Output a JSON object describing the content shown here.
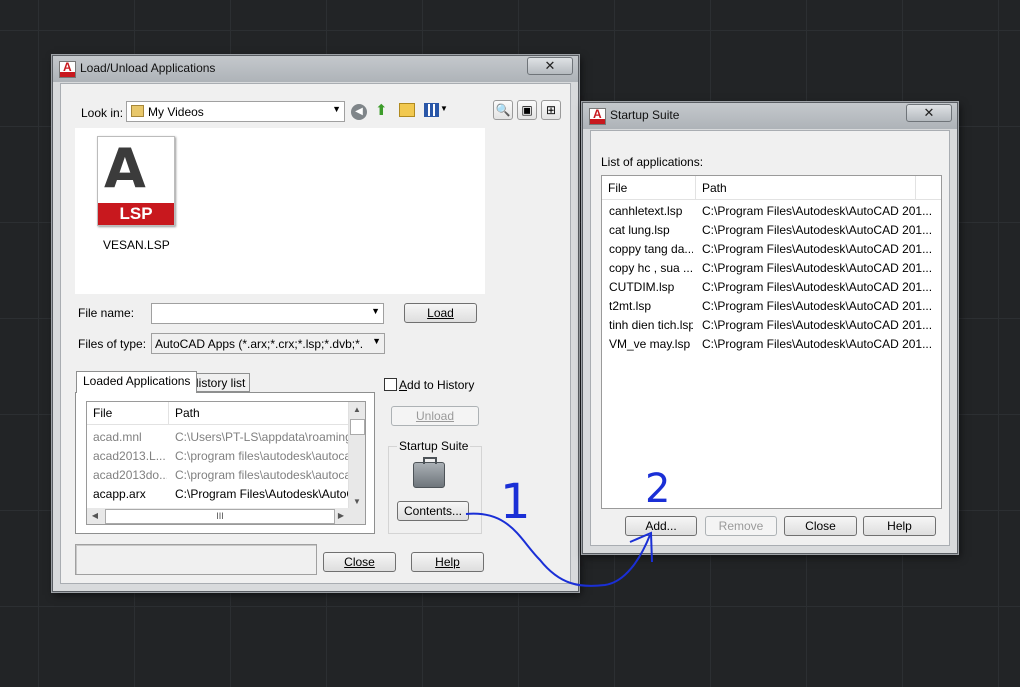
{
  "load_dialog": {
    "title": "Load/Unload Applications",
    "close_glyph": "✕",
    "look_in_label": "Look in:",
    "look_in_value": "My Videos",
    "file_icon_text": "LSP",
    "file_item_name": "VESAN.LSP",
    "file_name_label": "File name:",
    "file_name_value": "",
    "load_button": "Load",
    "files_of_type_label": "Files of type:",
    "files_of_type_value": "AutoCAD Apps (*.arx;*.crx;*.lsp;*.dvb;*.dbx;*.",
    "tabs": [
      "Loaded Applications",
      "History list"
    ],
    "add_to_history_label": "Add to History",
    "unload_button": "Unload",
    "startup_suite_label": "Startup Suite",
    "contents_button": "Contents...",
    "columns": [
      "File",
      "Path"
    ],
    "loaded_apps": [
      {
        "file": "acad.mnl",
        "path": "C:\\Users\\PT-LS\\appdata\\roaming\\.",
        "dim": true
      },
      {
        "file": "acad2013.L...",
        "path": "C:\\program files\\autodesk\\autocad .",
        "dim": true
      },
      {
        "file": "acad2013do...",
        "path": "C:\\program files\\autodesk\\autocad .",
        "dim": true
      },
      {
        "file": "acapp.arx",
        "path": "C:\\Program Files\\Autodesk\\AutoCA.",
        "dim": false
      }
    ],
    "hscroll_grip": "III",
    "status_text": "",
    "close_button": "Close",
    "help_button": "Help"
  },
  "startup_dialog": {
    "title": "Startup Suite",
    "close_glyph": "✕",
    "list_label": "List of applications:",
    "columns": [
      "File",
      "Path"
    ],
    "apps": [
      {
        "file": "canhletext.lsp",
        "path": "C:\\Program Files\\Autodesk\\AutoCAD 201..."
      },
      {
        "file": "cat lung.lsp",
        "path": "C:\\Program Files\\Autodesk\\AutoCAD 201..."
      },
      {
        "file": "coppy tang da...",
        "path": "C:\\Program Files\\Autodesk\\AutoCAD 201..."
      },
      {
        "file": "copy hc , sua ...",
        "path": "C:\\Program Files\\Autodesk\\AutoCAD 201..."
      },
      {
        "file": "CUTDIM.lsp",
        "path": "C:\\Program Files\\Autodesk\\AutoCAD 201..."
      },
      {
        "file": "t2mt.lsp",
        "path": "C:\\Program Files\\Autodesk\\AutoCAD 201..."
      },
      {
        "file": "tinh dien tich.lsp",
        "path": "C:\\Program Files\\Autodesk\\AutoCAD 201..."
      },
      {
        "file": "VM_ve may.lsp",
        "path": "C:\\Program Files\\Autodesk\\AutoCAD 201..."
      }
    ],
    "add_button": "Add...",
    "remove_button": "Remove",
    "close_button": "Close",
    "help_button": "Help"
  },
  "annotations": {
    "step1": "1",
    "step2": "2",
    "color": "#1a2fd6"
  },
  "colors": {
    "autocad_red": "#c8181e",
    "desktop": "#222426"
  }
}
